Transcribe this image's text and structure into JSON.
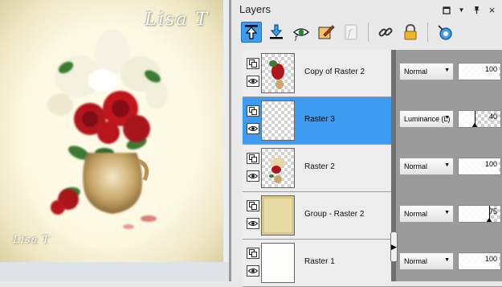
{
  "canvas": {
    "signature_top": "Lisa T",
    "signature_bottom": "Lisa T"
  },
  "panel": {
    "title": "Layers",
    "window_buttons": [
      "restore-icon",
      "pin-icon",
      "close-icon"
    ]
  },
  "toolbar": {
    "tools": [
      {
        "name": "move-layer-up-icon",
        "active": true
      },
      {
        "name": "move-layer-down-icon",
        "active": false
      },
      {
        "name": "toggle-visibility-icon",
        "active": false
      },
      {
        "name": "edit-selection-icon",
        "active": false
      },
      {
        "name": "script-icon",
        "active": false
      },
      {
        "name": "link-icon",
        "active": false
      },
      {
        "name": "lock-icon",
        "active": false
      },
      {
        "name": "mask-icon",
        "active": false
      }
    ]
  },
  "layers": [
    {
      "name": "Copy of Raster 2",
      "blend": "Normal",
      "opacity": 100,
      "selected": false
    },
    {
      "name": "Raster 3",
      "blend": "Luminance (L)",
      "opacity": 40,
      "selected": true
    },
    {
      "name": "Raster 2",
      "blend": "Normal",
      "opacity": 100,
      "selected": false
    },
    {
      "name": "Group - Raster 2",
      "blend": "Normal",
      "opacity": 75,
      "selected": false
    },
    {
      "name": "Raster 1",
      "blend": "Normal",
      "opacity": 100,
      "selected": false
    }
  ],
  "colors": {
    "selection": "#3d9bf2",
    "active_tool": "#3d9bf0",
    "flower_red": "#b0151c",
    "leaf_green": "#3b7b32"
  }
}
